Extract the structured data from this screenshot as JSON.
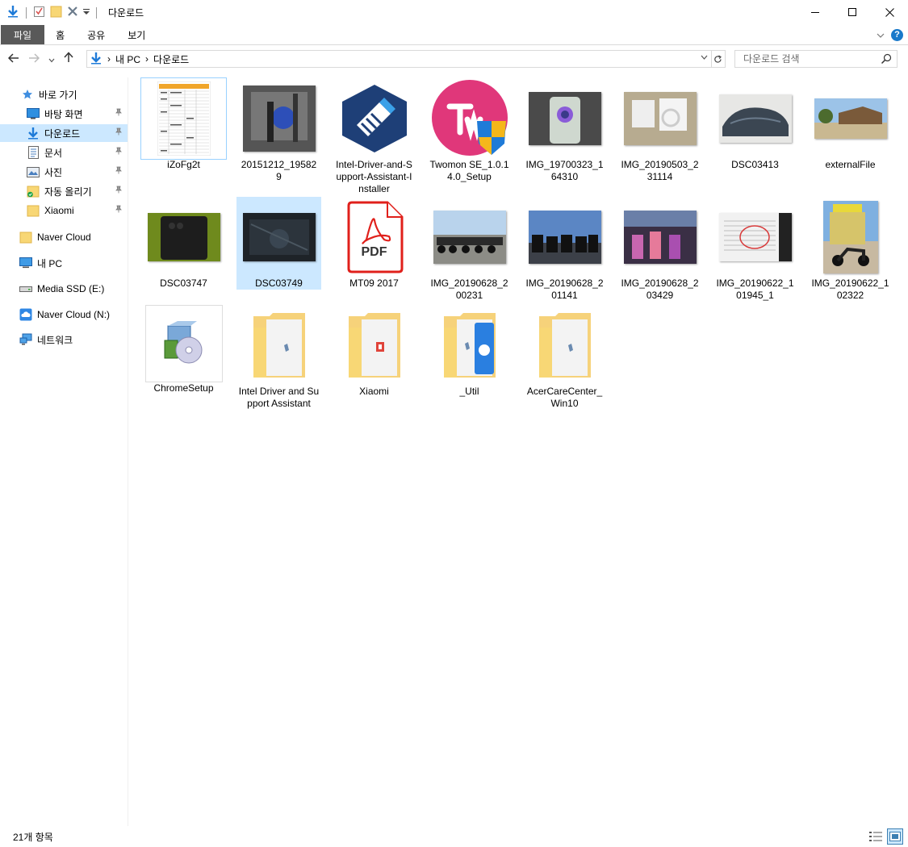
{
  "window": {
    "title": "다운로드",
    "minimize_glyph": "—",
    "maximize_glyph": "☐",
    "close_glyph": "✕"
  },
  "ribbon": {
    "tabs": [
      "파일",
      "홈",
      "공유",
      "보기"
    ],
    "collapse_glyph": "⌄",
    "help_glyph": "?"
  },
  "address": {
    "crumbs": [
      "내 PC",
      "다운로드"
    ],
    "separator": "›",
    "search_placeholder": "다운로드 검색"
  },
  "sidebar": {
    "quick_access": "바로 가기",
    "pinned": [
      {
        "label": "바탕 화면",
        "icon": "desktop-icon"
      },
      {
        "label": "다운로드",
        "icon": "download-icon"
      },
      {
        "label": "문서",
        "icon": "documents-icon"
      },
      {
        "label": "사진",
        "icon": "pictures-icon"
      },
      {
        "label": "자동 올리기",
        "icon": "folder-sync-icon"
      },
      {
        "label": "Xiaomi",
        "icon": "folder-icon"
      }
    ],
    "roots": [
      {
        "label": "Naver Cloud",
        "icon": "naver-cloud-folder-icon"
      },
      {
        "label": "내 PC",
        "icon": "pc-icon"
      },
      {
        "label": "Media SSD (E:)",
        "icon": "drive-icon"
      },
      {
        "label": "Naver Cloud (N:)",
        "icon": "cloud-drive-icon"
      },
      {
        "label": "네트워크",
        "icon": "network-icon"
      }
    ]
  },
  "files": [
    {
      "name": "iZoFg2t",
      "kind": "spreadsheet"
    },
    {
      "name": "20151212_195829",
      "kind": "photo"
    },
    {
      "name": "Intel-Driver-and-Support-Assistant-Installer",
      "kind": "app-intel"
    },
    {
      "name": "Twomon SE_1.0.14.0_Setup",
      "kind": "app-twomon"
    },
    {
      "name": "IMG_19700323_164310",
      "kind": "photo"
    },
    {
      "name": "IMG_20190503_231114",
      "kind": "photo"
    },
    {
      "name": "DSC03413",
      "kind": "photo"
    },
    {
      "name": "externalFile",
      "kind": "photo"
    },
    {
      "name": "DSC03747",
      "kind": "photo"
    },
    {
      "name": "DSC03749",
      "kind": "photo"
    },
    {
      "name": "MT09 2017",
      "kind": "pdf"
    },
    {
      "name": "IMG_20190628_200231",
      "kind": "photo"
    },
    {
      "name": "IMG_20190628_201141",
      "kind": "photo"
    },
    {
      "name": "IMG_20190628_203429",
      "kind": "photo"
    },
    {
      "name": "IMG_20190622_101945_1",
      "kind": "photo"
    },
    {
      "name": "IMG_20190622_102322",
      "kind": "photo"
    },
    {
      "name": "ChromeSetup",
      "kind": "installer"
    },
    {
      "name": "Intel Driver and Support Assistant",
      "kind": "folder"
    },
    {
      "name": "Xiaomi",
      "kind": "folder"
    },
    {
      "name": "_Util",
      "kind": "folder"
    },
    {
      "name": "AcerCareCenter_Win10",
      "kind": "folder"
    }
  ],
  "pdf_badge": "PDF",
  "status": {
    "item_count": "21개 항목"
  },
  "colors": {
    "selection": "#cce8ff",
    "accent": "#1979ca",
    "folder": "#f8d775"
  }
}
